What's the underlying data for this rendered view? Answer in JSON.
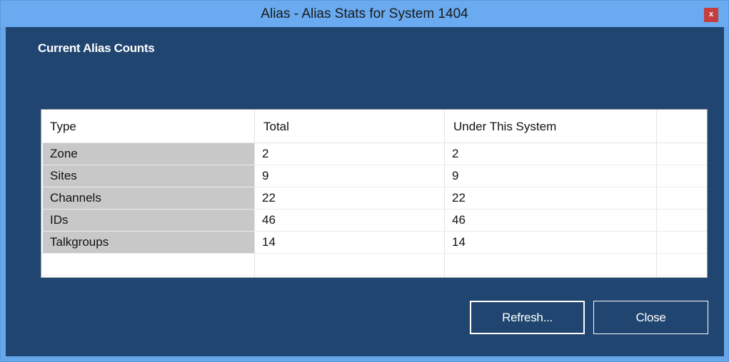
{
  "window": {
    "title": "Alias - Alias Stats for System 1404",
    "close_glyph": "x"
  },
  "section": {
    "title": "Current Alias Counts"
  },
  "table": {
    "columns": [
      "Type",
      "Total",
      "Under This System",
      ""
    ],
    "rows": [
      {
        "type": "Zone",
        "total": "2",
        "under": "2"
      },
      {
        "type": "Sites",
        "total": "9",
        "under": "9"
      },
      {
        "type": "Channels",
        "total": "22",
        "under": "22"
      },
      {
        "type": "IDs",
        "total": "46",
        "under": "46"
      },
      {
        "type": "Talkgroups",
        "total": "14",
        "under": "14"
      }
    ]
  },
  "buttons": {
    "refresh": "Refresh...",
    "close": "Close"
  },
  "colors": {
    "titlebar": "#69aaf0",
    "client": "#1f4570",
    "close_button": "#c63d3d",
    "row_header": "#c8c8c8"
  },
  "icons": {
    "close": "close-icon"
  }
}
